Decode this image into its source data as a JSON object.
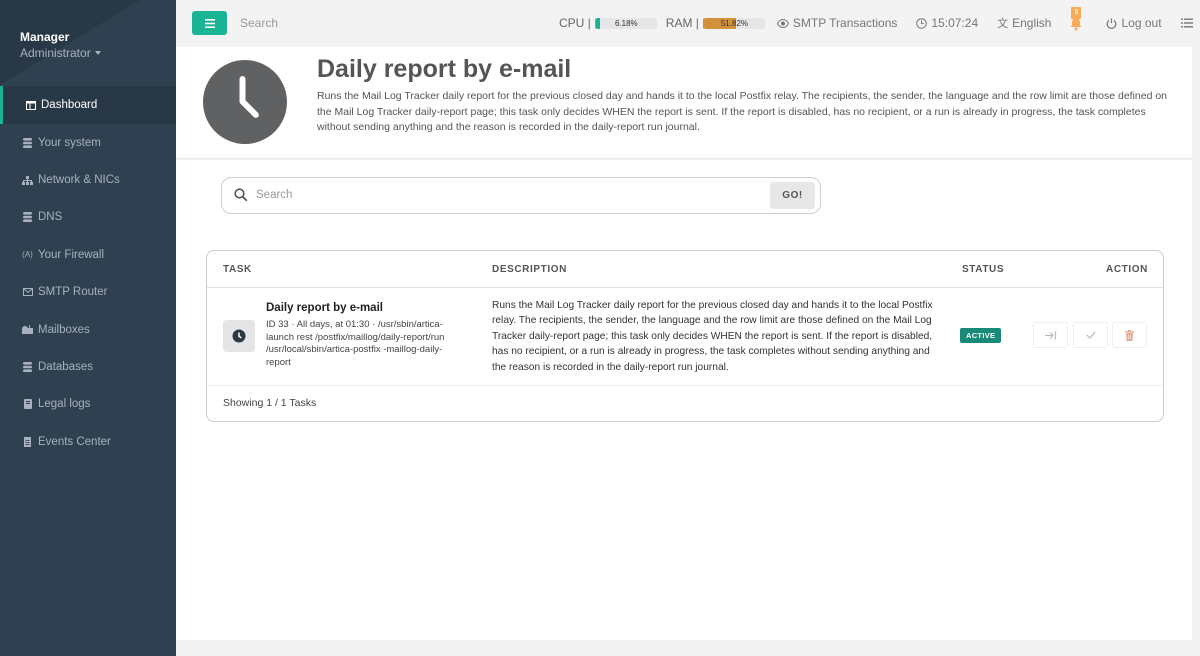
{
  "sidebar": {
    "user_name": "Manager",
    "user_role": "Administrator",
    "items": [
      {
        "label": "Dashboard",
        "icon": "dashboard-icon"
      },
      {
        "label": "Your system",
        "icon": "database-icon"
      },
      {
        "label": "Network & NICs",
        "icon": "sitemap-icon"
      },
      {
        "label": "DNS",
        "icon": "database-icon"
      },
      {
        "label": "Your Firewall",
        "icon": "firewall-icon"
      },
      {
        "label": "SMTP Router",
        "icon": "envelope-icon"
      },
      {
        "label": "Mailboxes",
        "icon": "mailbox-icon"
      },
      {
        "label": "Databases",
        "icon": "database-icon"
      },
      {
        "label": "Legal logs",
        "icon": "book-icon"
      },
      {
        "label": "Events Center",
        "icon": "file-icon"
      }
    ]
  },
  "topbar": {
    "search_placeholder": "Search",
    "cpu_label": "CPU |",
    "cpu_value": "6.18%",
    "cpu_fraction": 0.0618,
    "ram_label": "RAM |",
    "ram_value": "51.82%",
    "ram_fraction": 0.5182,
    "smtp_label": "SMTP Transactions",
    "time": "15:07:24",
    "language": "English",
    "notifications_count": "8",
    "logout_label": "Log out"
  },
  "header": {
    "title": "Daily report by e-mail",
    "description": "Runs the Mail Log Tracker daily report for the previous closed day and hands it to the local Postfix relay. The recipients, the sender, the language and the row limit are those defined on the Mail Log Tracker daily-report page; this task only decides WHEN the report is sent. If the report is disabled, has no recipient, or a run is already in progress, the task completes without sending anything and the reason is recorded in the daily-report run journal."
  },
  "search": {
    "placeholder": "Search",
    "button_label": "GO!"
  },
  "table": {
    "columns": [
      "TASK",
      "DESCRIPTION",
      "STATUS",
      "ACTION"
    ],
    "rows": [
      {
        "name": "Daily report by e-mail",
        "meta": "ID 33 · All days, at 01:30 · /usr/sbin/artica-launch rest /postfix/maillog/daily-report/run /usr/local/sbin/artica-postfix -maillog-daily-report",
        "description": "Runs the Mail Log Tracker daily report for the previous closed day and hands it to the local Postfix relay. The recipients, the sender, the language and the row limit are those defined on the Mail Log Tracker daily-report page; this task only decides WHEN the report is sent. If the report is disabled, has no recipient, or a run is already in progress, the task completes without sending anything and the reason is recorded in the daily-report run journal.",
        "status": "ACTIVE"
      }
    ],
    "footer": "Showing 1 / 1 Tasks"
  },
  "colors": {
    "sidebar_bg": "#2f4050",
    "accent": "#1ab394",
    "ram_bar": "#d3923a",
    "status_active": "#1a8a78"
  }
}
